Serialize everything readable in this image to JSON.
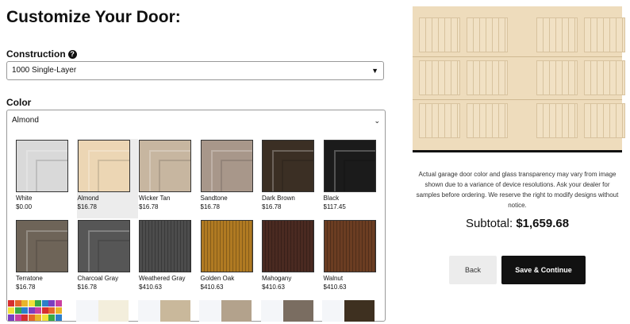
{
  "header": {
    "title": "Customize Your Door:"
  },
  "construction": {
    "label": "Construction",
    "help_icon": "question-circle-icon",
    "value": "1000 Single-Layer"
  },
  "color": {
    "label": "Color",
    "selected": "Almond",
    "swatches": [
      {
        "name": "White",
        "price": "$0.00",
        "color": "#d9d9d9",
        "wood": false
      },
      {
        "name": "Almond",
        "price": "$16.78",
        "color": "#ecd6b4",
        "wood": false,
        "selected": true
      },
      {
        "name": "Wicker Tan",
        "price": "$16.78",
        "color": "#c7b6a0",
        "wood": false
      },
      {
        "name": "Sandtone",
        "price": "$16.78",
        "color": "#a8978a",
        "wood": false
      },
      {
        "name": "Dark Brown",
        "price": "$16.78",
        "color": "#3b2f24",
        "wood": false
      },
      {
        "name": "Black",
        "price": "$117.45",
        "color": "#1b1b1b",
        "wood": false
      },
      {
        "name": "Terratone",
        "price": "$16.78",
        "color": "#6e6458",
        "wood": false
      },
      {
        "name": "Charcoal Gray",
        "price": "$16.78",
        "color": "#565656",
        "wood": false
      },
      {
        "name": "Weathered Gray",
        "price": "$410.63",
        "color": "#4c4c4c",
        "wood": true
      },
      {
        "name": "Golden Oak",
        "price": "$410.63",
        "color": "#b07a22",
        "wood": true
      },
      {
        "name": "Mahogany",
        "price": "$410.63",
        "color": "#4a2a21",
        "wood": true
      },
      {
        "name": "Walnut",
        "price": "$410.63",
        "color": "#6b3d22",
        "wood": true
      }
    ],
    "partial_row_colors": [
      "#f3eedc",
      "#c9b89b",
      "#b3a28c",
      "#7a6d61",
      "#3e3020"
    ]
  },
  "preview": {
    "disclaimer": "Actual garage door color and glass transparency may vary from image shown due to a variance of device resolutions. Ask your dealer for samples before ordering. We reserve the right to modify designs without notice."
  },
  "subtotal": {
    "label": "Subtotal:",
    "value": "$1,659.68"
  },
  "actions": {
    "back_label": "Back",
    "continue_label": "Save & Continue"
  }
}
